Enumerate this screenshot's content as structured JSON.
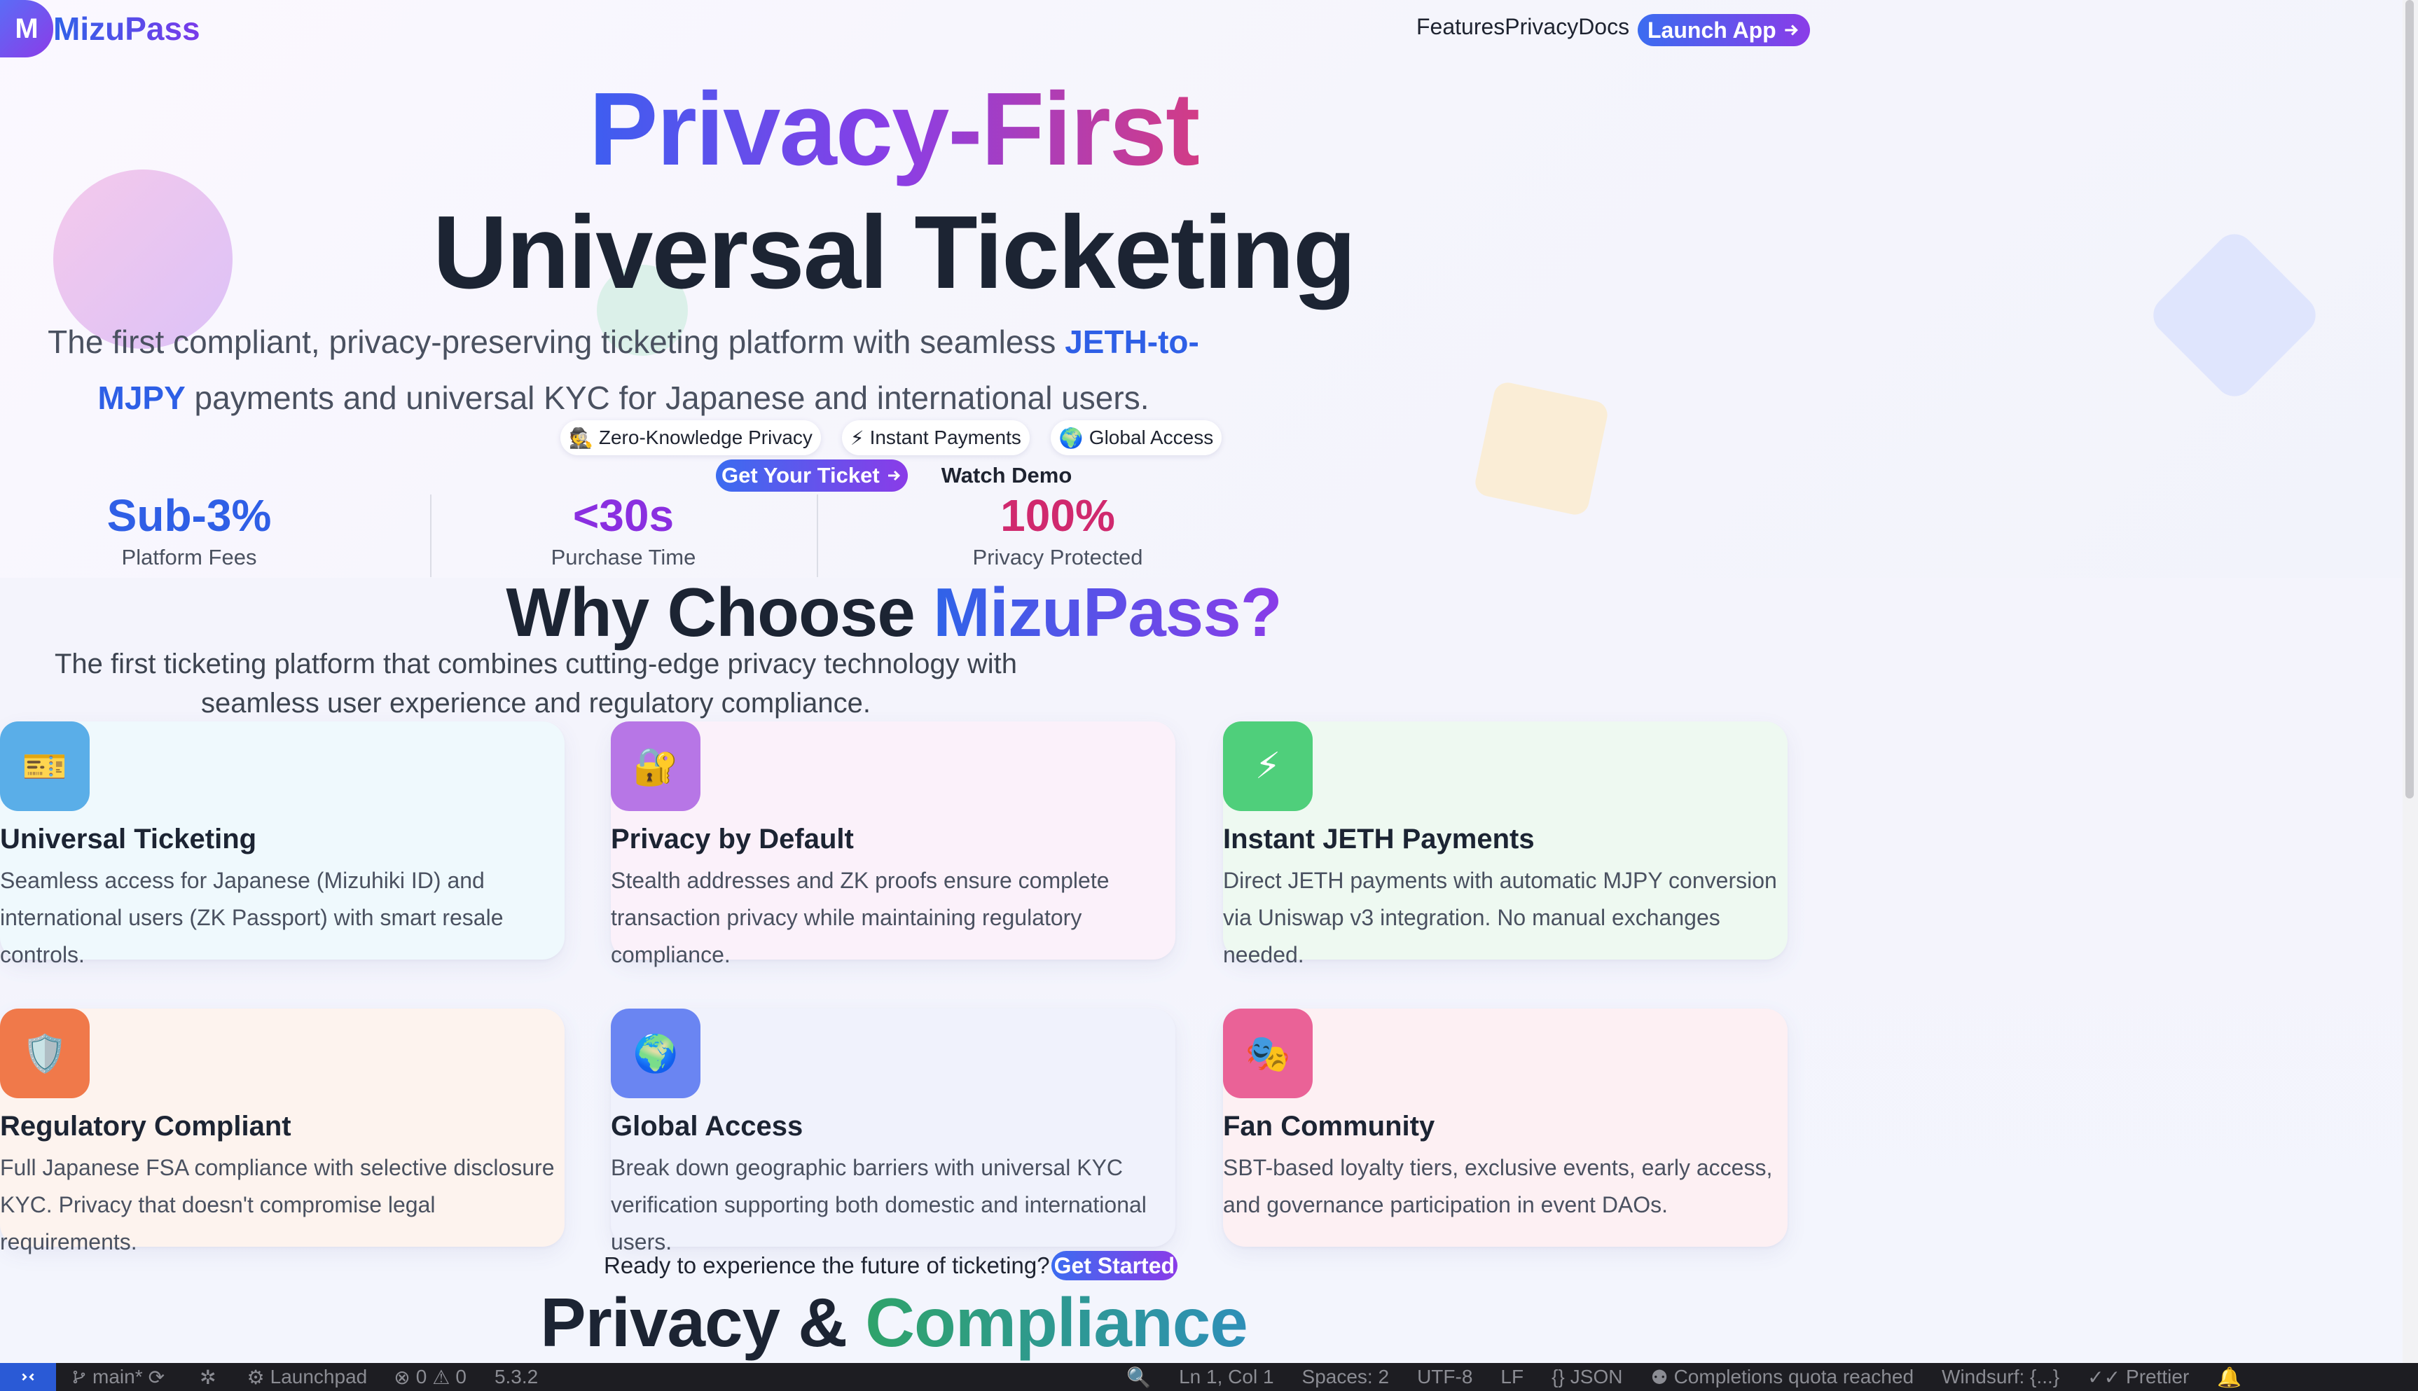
{
  "nav": {
    "logo_letter": "M",
    "brand": "MizuPass",
    "links": [
      "Features",
      "Privacy",
      "Docs"
    ],
    "launch_label": "Launch App",
    "launch_icon": "arrow-right-icon"
  },
  "hero": {
    "title_line1": "Privacy-First",
    "title_line2": "Universal Ticketing",
    "subtitle_before": "The first compliant, privacy-preserving ticketing platform with seamless ",
    "subtitle_accent": "JETH-to-MJPY",
    "subtitle_after": " payments and universal KYC for Japanese and international users.",
    "pills": [
      {
        "icon": "🕵️",
        "label": "Zero-Knowledge Privacy"
      },
      {
        "icon": "⚡",
        "label": "Instant Payments"
      },
      {
        "icon": "🌍",
        "label": "Global Access"
      }
    ],
    "primary_cta": "Get Your Ticket",
    "secondary_cta": "Watch Demo"
  },
  "stats": [
    {
      "value": "Sub-3%",
      "label": "Platform Fees",
      "color": "#2f5fe6"
    },
    {
      "value": "<30s",
      "label": "Purchase Time",
      "color": "#8a2fe0"
    },
    {
      "value": "100%",
      "label": "Privacy Protected",
      "color": "#d0296e"
    }
  ],
  "why": {
    "title_prefix": "Why Choose ",
    "title_accent": "MizuPass?",
    "subtitle": "The first ticketing platform that combines cutting-edge privacy technology with seamless user experience and regulatory compliance."
  },
  "features": [
    {
      "icon": "🎫",
      "icon_name": "ticket-icon",
      "title": "Universal Ticketing",
      "desc": "Seamless access for Japanese (Mizuhiki ID) and international users (ZK Passport) with smart resale controls.",
      "icon_bg": "#5aaee8",
      "card_bg": "#eff9fd"
    },
    {
      "icon": "🔐",
      "icon_name": "lock-icon",
      "title": "Privacy by Default",
      "desc": "Stealth addresses and ZK proofs ensure complete transaction privacy while maintaining regulatory compliance.",
      "icon_bg": "#b776e6",
      "card_bg": "#fbf1fa"
    },
    {
      "icon": "⚡",
      "icon_name": "lightning-icon",
      "title": "Instant JETH Payments",
      "desc": "Direct JETH payments with automatic MJPY conversion via Uniswap v3 integration. No manual exchanges needed.",
      "icon_bg": "#4fcf7b",
      "card_bg": "#eef9f1"
    },
    {
      "icon": "🛡️",
      "icon_name": "shield-icon",
      "title": "Regulatory Compliant",
      "desc": "Full Japanese FSA compliance with selective disclosure KYC. Privacy that doesn't compromise legal requirements.",
      "icon_bg": "#f0794a",
      "card_bg": "#fdf3ee"
    },
    {
      "icon": "🌍",
      "icon_name": "globe-icon",
      "title": "Global Access",
      "desc": "Break down geographic barriers with universal KYC verification supporting both domestic and international users.",
      "icon_bg": "#6a85f2",
      "card_bg": "#f0f2fc"
    },
    {
      "icon": "🎭",
      "icon_name": "theater-masks-icon",
      "title": "Fan Community",
      "desc": "SBT-based loyalty tiers, exclusive events, early access, and governance participation in event DAOs.",
      "icon_bg": "#ea6297",
      "card_bg": "#fdf0f3"
    }
  ],
  "ready": {
    "text": "Ready to experience the future of ticketing?",
    "button": "Get Started"
  },
  "privacy_section": {
    "title_prefix": "Privacy & ",
    "title_accent": "Compliance"
  },
  "statusbar": {
    "branch": "main*",
    "launchpad": "Launchpad",
    "errors": "0",
    "warnings": "0",
    "version": "5.3.2",
    "position": "Ln 1, Col 1",
    "spaces": "Spaces: 2",
    "encoding": "UTF-8",
    "eol": "LF",
    "language": "JSON",
    "completions": "Completions quota reached",
    "windsurf": "Windsurf: {...}",
    "prettier": "Prettier"
  }
}
